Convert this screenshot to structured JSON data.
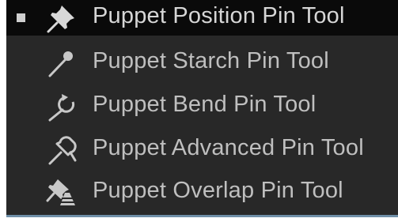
{
  "menu": {
    "items": [
      {
        "label": "Puppet Position Pin Tool",
        "icon": "pushpin-icon",
        "active": true
      },
      {
        "label": "Puppet Starch Pin Tool",
        "icon": "starch-pin-icon",
        "active": false
      },
      {
        "label": "Puppet Bend Pin Tool",
        "icon": "bend-pin-icon",
        "active": false
      },
      {
        "label": "Puppet Advanced Pin Tool",
        "icon": "advanced-pin-icon",
        "active": false
      },
      {
        "label": "Puppet Overlap Pin Tool",
        "icon": "overlap-pin-icon",
        "active": false
      }
    ]
  },
  "colors": {
    "panel_bg": "#282828",
    "active_bg": "#0a0a0a",
    "text": "#bfbfbf",
    "bottom_border": "#6f8fa8"
  }
}
